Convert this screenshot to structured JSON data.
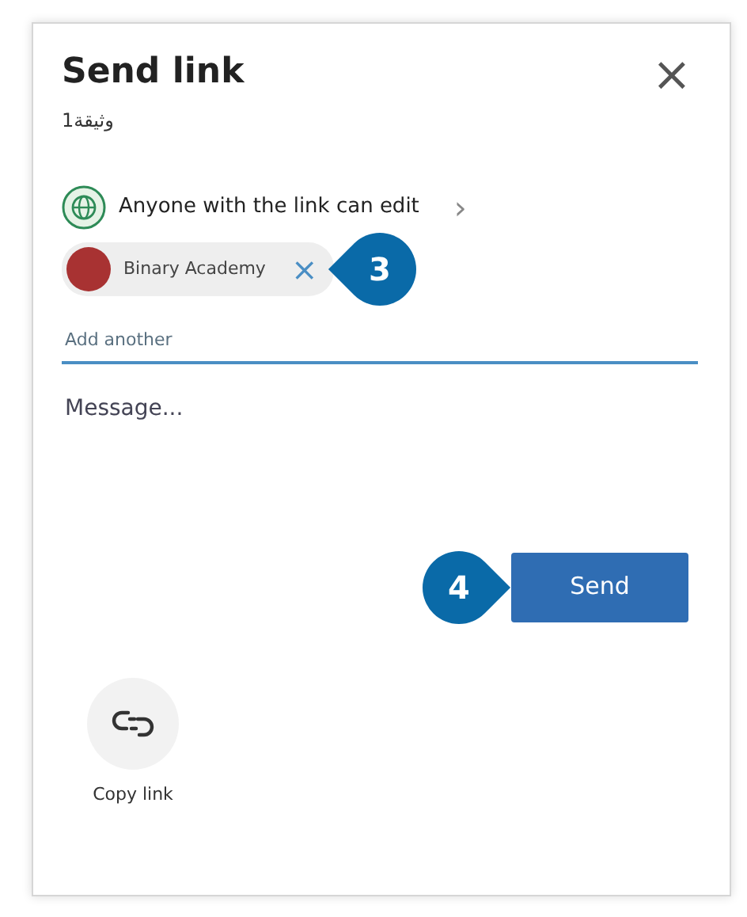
{
  "dialog": {
    "title": "Send link",
    "subtitle": "وثيقة1",
    "close": "×"
  },
  "permission": {
    "label": "Anyone with the link can edit",
    "chevron": "›"
  },
  "recipients": [
    {
      "name": "Binary Academy",
      "remove": "×",
      "color": "#a83232"
    }
  ],
  "add_field": {
    "placeholder": "Add another"
  },
  "message": {
    "placeholder": "Message..."
  },
  "send_button": "Send",
  "copy_link": {
    "label": "Copy link"
  },
  "callouts": [
    {
      "number": "3",
      "kind": "leftward"
    },
    {
      "number": "4",
      "kind": "rightward"
    }
  ]
}
